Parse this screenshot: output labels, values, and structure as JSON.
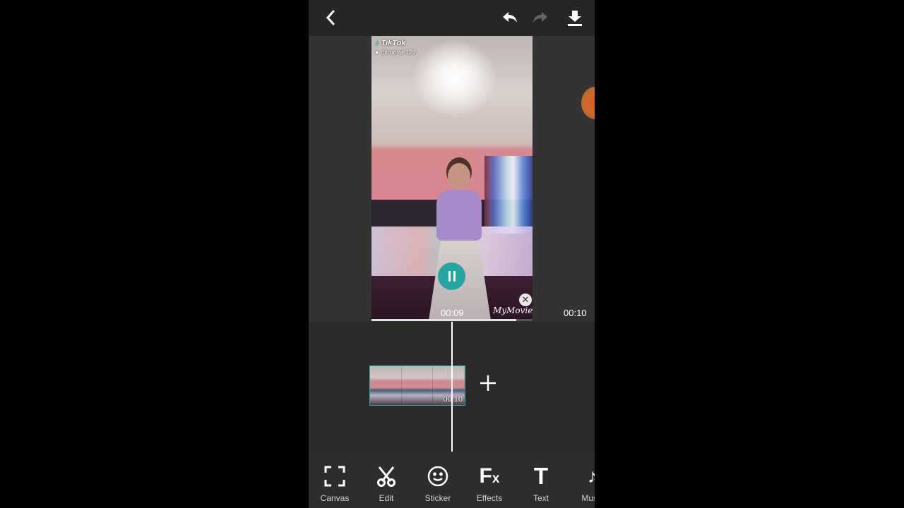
{
  "topbar": {
    "back_icon": "chevron-left-icon",
    "undo_icon": "undo-icon",
    "redo_icon": "redo-icon",
    "download_icon": "download-icon"
  },
  "preview": {
    "watermark_brand": "TikTok",
    "watermark_user": "@rubya.123",
    "app_watermark": "MyMovie",
    "current_time": "00:09",
    "total_time": "00:10",
    "progress_fraction": 0.9,
    "pause_icon": "pause-icon",
    "remove_watermark_icon": "close-icon"
  },
  "timeline": {
    "clip_duration": "00:10",
    "thumbnail_count": 3,
    "add_icon": "plus-icon"
  },
  "toolbar": {
    "items": [
      {
        "label": "Canvas",
        "icon": "canvas-icon"
      },
      {
        "label": "Edit",
        "icon": "scissors-icon"
      },
      {
        "label": "Sticker",
        "icon": "smiley-icon"
      },
      {
        "label": "Effects",
        "icon": "fx-icon"
      },
      {
        "label": "Text",
        "icon": "text-icon"
      },
      {
        "label": "Music",
        "icon": "music-note-icon"
      }
    ]
  },
  "colors": {
    "accent": "#26a6a2",
    "clip_border": "#2bb5ac",
    "background": "#2a2a2a"
  }
}
